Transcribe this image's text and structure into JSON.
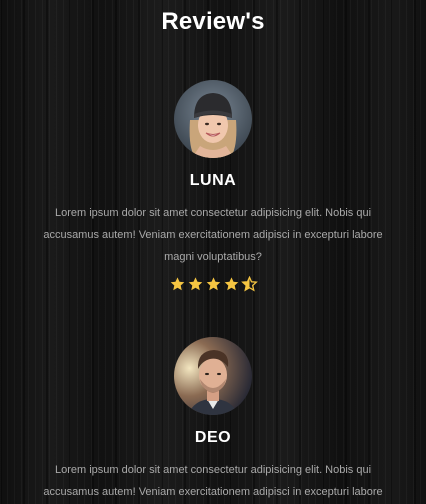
{
  "page": {
    "title": "Review's"
  },
  "reviews": [
    {
      "name": "LUNA",
      "text": "Lorem ipsum dolor sit amet consectetur adipisicing elit. Nobis qui accusamus autem! Veniam exercitationem adipisci in excepturi labore magni voluptatibus?",
      "rating": 4.5,
      "rating_max": 5,
      "avatar_icon": "avatar-woman-beanie"
    },
    {
      "name": "DEO",
      "text": "Lorem ipsum dolor sit amet consectetur adipisicing elit. Nobis qui accusamus autem! Veniam exercitationem adipisci in excepturi labore",
      "avatar_icon": "avatar-man"
    }
  ],
  "colors": {
    "star": "#f5c542",
    "text_muted": "#a9a9a9",
    "heading": "#ffffff"
  }
}
